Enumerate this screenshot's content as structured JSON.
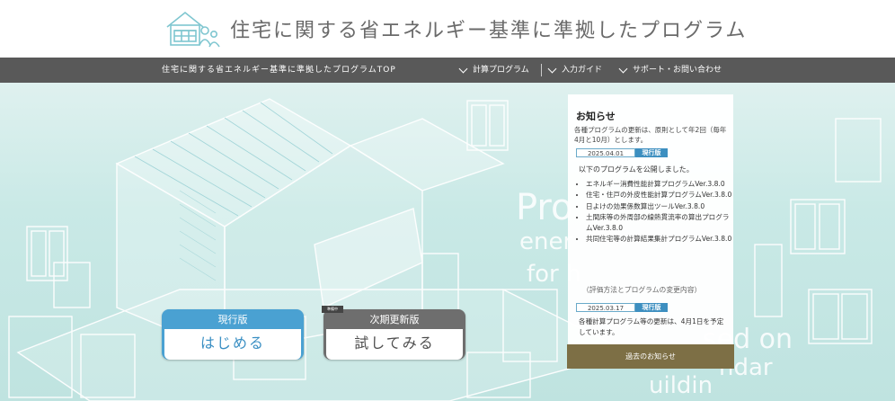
{
  "header": {
    "title": "住宅に関する省エネルギー基準に準拠したプログラム"
  },
  "nav": {
    "top_link": "住宅に関する省エネルギー基準に準拠したプログラムTOP",
    "menus": [
      {
        "label": "計算プログラム",
        "icon": "chevron-down-icon"
      },
      {
        "label": "入力ガイド",
        "icon": "chevron-down-icon"
      },
      {
        "label": "サポート・お問い合わせ",
        "icon": "chevron-down-icon"
      }
    ]
  },
  "hero": {
    "watermark": [
      "Pro",
      "ener",
      "for h",
      "sed on",
      "ndar",
      "uildin"
    ],
    "current_button": {
      "top": "現行版",
      "bottom": "はじめる"
    },
    "next_button": {
      "badge": "準備中",
      "top": "次期更新版",
      "bottom": "試してみる"
    }
  },
  "notice": {
    "title": "お知らせ",
    "lead": "各種プログラムの更新は、原則として年2回（毎年4月と10月）とします。",
    "items": [
      {
        "date": "2025.04.01",
        "tag": "現行版",
        "intro": "以下のプログラムを公開しました。",
        "list": [
          "エネルギー消費性能計算プログラムVer.3.8.0",
          "住宅・住戸の外皮性能計算プログラムVer.3.8.0",
          "日よけの効果係数算出ツールVer.3.8.0",
          "土間床等の外周部の線熱貫流率の算出プログラムVer.3.8.0",
          "共同住宅等の計算結果集計プログラムVer.3.8.0"
        ],
        "method": "（評価方法とプログラムの変更内容）"
      },
      {
        "date": "2025.03.17",
        "tag": "現行版",
        "msg": "各種計算プログラム等の更新は、4月1日を予定しています。"
      }
    ],
    "past_button": "過去のお知らせ"
  },
  "colors": {
    "nav_bg": "#595959",
    "accent_blue": "#4aa1d2",
    "past_btn": "#7d6f45",
    "hero_bg": "#c9e9e6"
  }
}
